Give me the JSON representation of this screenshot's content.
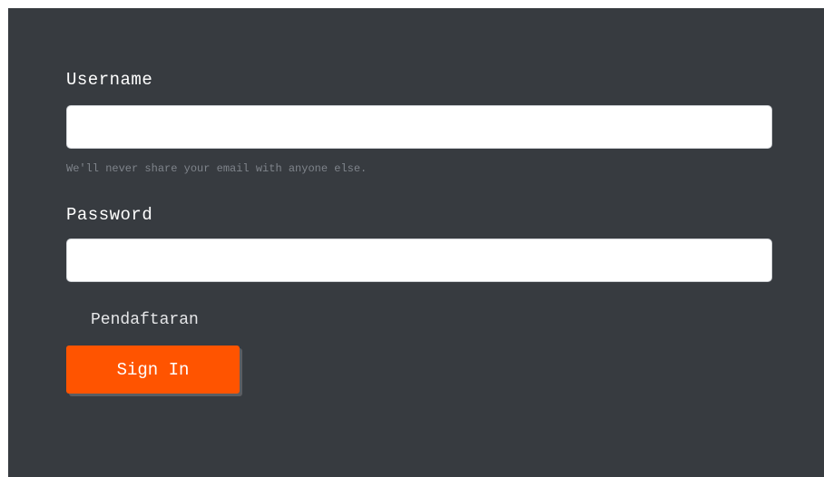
{
  "form": {
    "username": {
      "label": "Username",
      "value": "",
      "help_text": "We'll never share your email with anyone else."
    },
    "password": {
      "label": "Password",
      "value": ""
    },
    "register_link": "Pendaftaran",
    "signin_button": "Sign In"
  },
  "colors": {
    "panel_background": "#373b40",
    "button_background": "#ff5400",
    "input_background": "#ffffff",
    "help_text": "#7f848b"
  }
}
